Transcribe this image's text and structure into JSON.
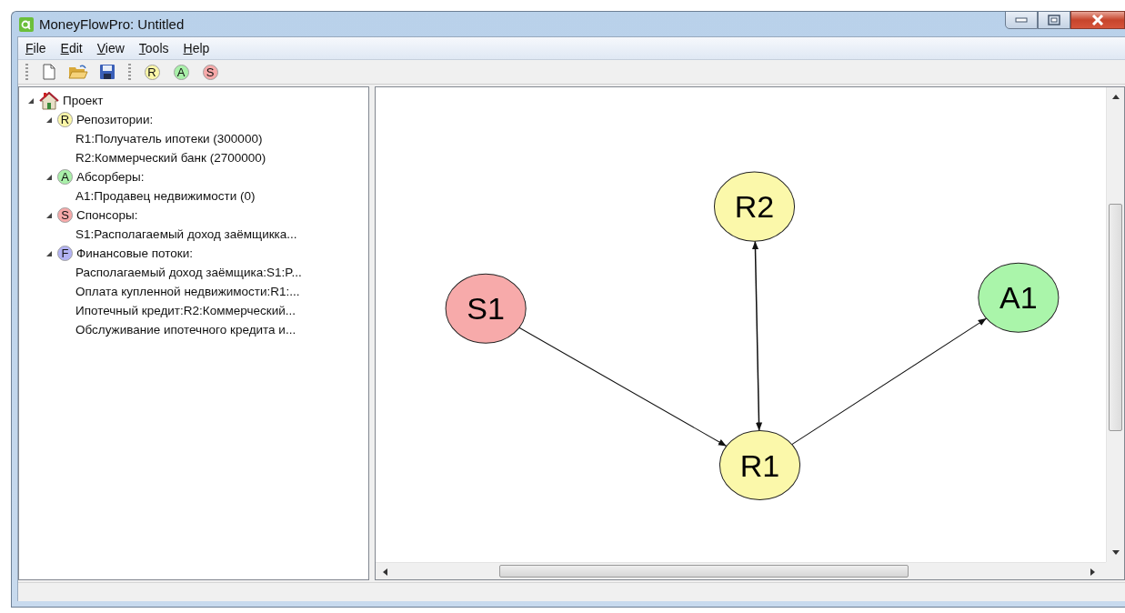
{
  "window": {
    "title": "MoneyFlowPro: Untitled"
  },
  "menu": [
    {
      "label": "File"
    },
    {
      "label": "Edit"
    },
    {
      "label": "View"
    },
    {
      "label": "Tools"
    },
    {
      "label": "Help"
    }
  ],
  "toolbar": {
    "badges": [
      {
        "letter": "R",
        "color": "#fbf7a8"
      },
      {
        "letter": "A",
        "color": "#a9f0a9"
      },
      {
        "letter": "S",
        "color": "#f7a9a9"
      }
    ]
  },
  "tree": {
    "label": "Проект",
    "expanded": true,
    "children": [
      {
        "label": "Репозитории:",
        "badge": "R",
        "color": "#fbf7a8",
        "expanded": true,
        "children": [
          {
            "label": "R1:Получатель ипотеки (300000)"
          },
          {
            "label": "R2:Коммерческий банк (2700000)"
          }
        ]
      },
      {
        "label": "Абсорберы:",
        "badge": "A",
        "color": "#a9f0a9",
        "expanded": true,
        "children": [
          {
            "label": "A1:Продавец недвижимости (0)"
          }
        ]
      },
      {
        "label": "Спонсоры:",
        "badge": "S",
        "color": "#f7a9a9",
        "expanded": true,
        "children": [
          {
            "label": "S1:Располагаемый доход заёмщикка..."
          }
        ]
      },
      {
        "label": "Финансовые потоки:",
        "badge": "F",
        "color": "#b3b3f5",
        "expanded": true,
        "children": [
          {
            "label": "Располагаемый доход заёмщика:S1:P..."
          },
          {
            "label": "Оплата купленной недвижимости:R1:..."
          },
          {
            "label": "Ипотечный кредит:R2:Коммерческий..."
          },
          {
            "label": "Обслуживание ипотечного кредита и..."
          }
        ]
      }
    ]
  },
  "diagram": {
    "nodes": [
      {
        "label": "S1",
        "color": "#f7aaaa"
      },
      {
        "label": "R2",
        "color": "#fbf8aa"
      },
      {
        "label": "A1",
        "color": "#aaf5aa"
      },
      {
        "label": "R1",
        "color": "#fbf8aa"
      }
    ],
    "edges": [
      {
        "kind": "arrow"
      },
      {
        "kind": "double-arrow"
      },
      {
        "kind": "arrow"
      }
    ]
  }
}
